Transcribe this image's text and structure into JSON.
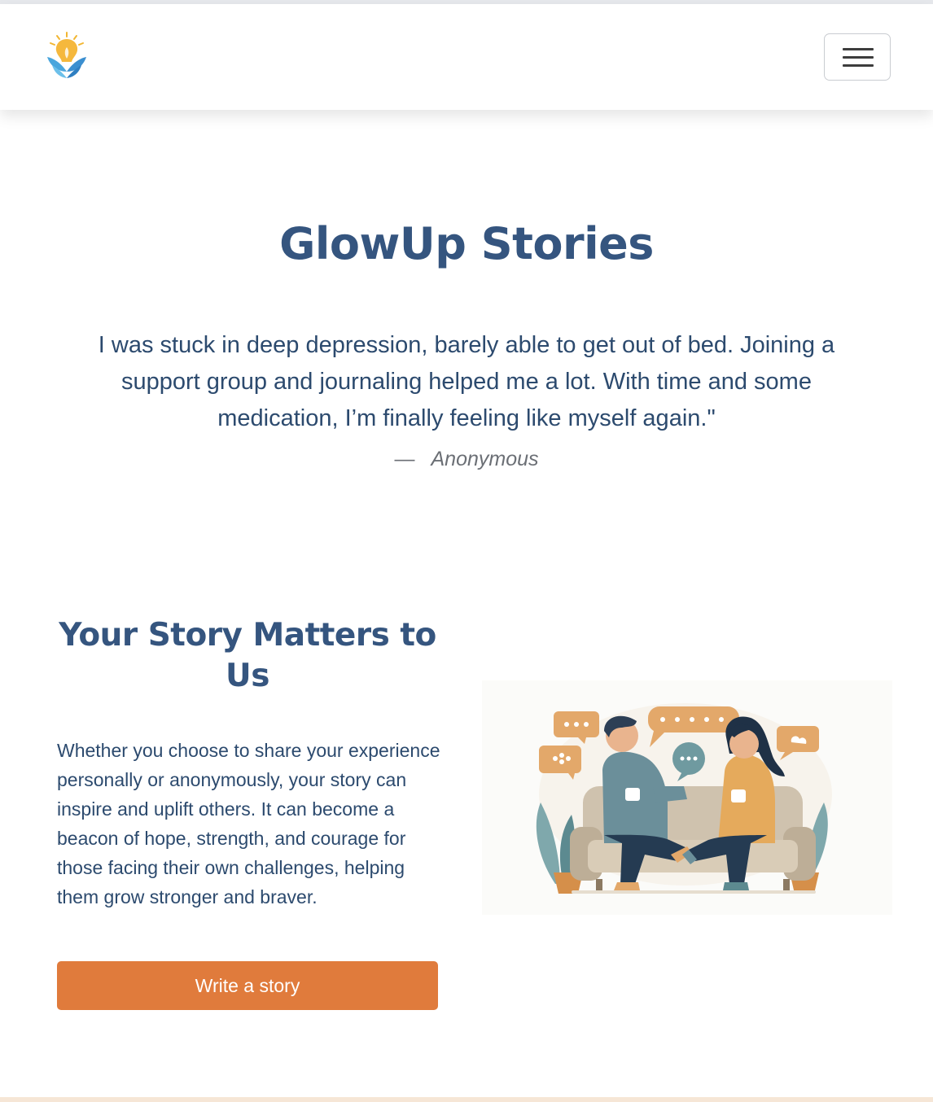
{
  "colors": {
    "accent": "#e07b3c",
    "heading": "#35557f",
    "text": "#2c4a6e",
    "muted": "#6b6f75"
  },
  "navbar": {
    "logo_icon": "lightbulb-leaf-logo-icon",
    "menu_icon": "hamburger-menu-icon"
  },
  "hero": {
    "title": "GlowUp Stories",
    "quote": "I was stuck in deep depression, barely able to get out of bed. Joining a support group and journaling helped me a lot. With time and some medication, I’m finally feeling like myself again.\"",
    "author_dash": "—",
    "author": "Anonymous"
  },
  "story_section": {
    "title": "Your Story Matters to Us",
    "body": "Whether you choose to share your experience personally or anonymously, your story can inspire and uplift others. It can become a beacon of hope, strength, and courage for those facing their own challenges, helping them grow stronger and braver.",
    "button_label": "Write a story",
    "illustration_icon": "two-people-chatting-on-sofa-illustration"
  }
}
